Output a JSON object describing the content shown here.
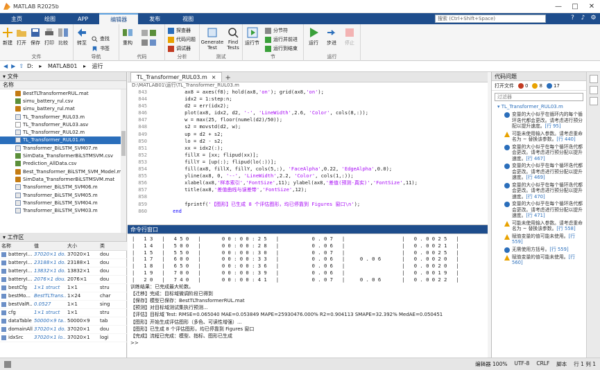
{
  "window": {
    "title": "MATLAB R2025b",
    "controls": [
      "—",
      "□",
      "✕"
    ]
  },
  "tabs": [
    {
      "label": "主页",
      "active": false
    },
    {
      "label": "绘图",
      "active": false
    },
    {
      "label": "APP",
      "active": false
    },
    {
      "label": "编辑器",
      "active": true
    },
    {
      "label": "发布",
      "active": false
    },
    {
      "label": "视图",
      "active": false
    }
  ],
  "search": {
    "placeholder": "搜索 (Ctrl+Shift+Space)"
  },
  "ribbon": {
    "file": {
      "label": "文件",
      "new": "新建",
      "open": "打开",
      "save": "保存",
      "print": "打印",
      "compare": "比较"
    },
    "navigate": {
      "label": "导航",
      "goto": "转至",
      "find": "查找",
      "bookmark": "书签"
    },
    "code": {
      "label": "代码",
      "refactor": "重构"
    },
    "analyze": {
      "label": "分析",
      "profiler": "探查器",
      "code_issues": "代码问题",
      "debugger": "调试器"
    },
    "test": {
      "label": "测试",
      "generate": "Generate Test",
      "find_tests": "Find Tests"
    },
    "section": {
      "label": "节",
      "run_section": "运行节",
      "section_break": "分节符",
      "run_advance": "运行并前进",
      "run_end": "运行到结束"
    },
    "run": {
      "label": "运行",
      "run": "运行",
      "step": "步进",
      "stop": "停止"
    }
  },
  "address": {
    "parts": [
      "D:",
      "MATLAB01",
      "运行"
    ]
  },
  "files": {
    "panel_title": "文件",
    "col_name": "名称",
    "items": [
      {
        "name": "BestTLTransformerRUL.mat",
        "type": "mat"
      },
      {
        "name": "simu_battery_rul.csv",
        "type": "csv"
      },
      {
        "name": "simu_battery_rul.mat",
        "type": "mat"
      },
      {
        "name": "TL_Transformer_RUL03.m",
        "type": "m"
      },
      {
        "name": "TL_Transformer_RUL03.asv",
        "type": "asv"
      },
      {
        "name": "TL_Transformer_RUL02.m",
        "type": "m"
      },
      {
        "name": "TL_Transformer_RUL01.m",
        "type": "m",
        "selected": true
      },
      {
        "name": "Transformer_BiLSTM_SVM07.m",
        "type": "m"
      },
      {
        "name": "SimData_TransformerBiLSTMSVM.csv",
        "type": "csv"
      },
      {
        "name": "Prediction_AllData.csv",
        "type": "csv"
      },
      {
        "name": "Best_Transformer_BiLSTM_SVM_Model.mat",
        "type": "mat"
      },
      {
        "name": "SimData_TransformerBiLSTMSVM.mat",
        "type": "mat"
      },
      {
        "name": "Transformer_BiLSTM_SVM06.m",
        "type": "m"
      },
      {
        "name": "Transformer_BiLSTM_SVM05.m",
        "type": "m"
      },
      {
        "name": "Transformer_BiLSTM_SVM04.m",
        "type": "m"
      },
      {
        "name": "Transformer_BiLSTM_SVM03.m",
        "type": "m"
      }
    ]
  },
  "workspace": {
    "panel_title": "工作区",
    "cols": [
      "名称",
      "值",
      "大小",
      "类"
    ],
    "rows": [
      [
        "batteryI...",
        "37020×1 do...",
        "37020×1",
        "dou"
      ],
      [
        "batteryI...",
        "23188×1 do...",
        "23188×1",
        "dou"
      ],
      [
        "batteryI...",
        "13832×1 do...",
        "13832×1",
        "dou"
      ],
      [
        "batteryI...",
        "2076×1 dou...",
        "2076×1",
        "dou"
      ],
      [
        "bestCfg",
        "1×1 struct",
        "1×1",
        "stru"
      ],
      [
        "bestMo...",
        "BestTLTrans...",
        "1×24",
        "char"
      ],
      [
        "bestValR...",
        "0.0527",
        "1×1",
        "sing"
      ],
      [
        "cfg",
        "1×1 struct",
        "1×1",
        "stru"
      ],
      [
        "dataTable",
        "50000×9 ta...",
        "50000×9",
        "tab"
      ],
      [
        "domainAll",
        "37020×1 do...",
        "37020×1",
        "dou"
      ],
      [
        "idxSrc",
        "37020×1 lo...",
        "37020×1",
        "logi"
      ]
    ]
  },
  "editor": {
    "tab_title": "TL_Transformer_RUL03.m",
    "tab_close": "×",
    "breadcrumb": "D:\\MATLAB01\\运行\\TL_Transformer_RUL03.m",
    "lines": [
      {
        "n": "843",
        "code": "        ax8 = axes(f8); hold(ax8,'on'); grid(ax8,'on');"
      },
      {
        "n": "844",
        "code": "        idx2 = 1:step:n;"
      },
      {
        "n": "845",
        "code": "        d2 = err(idx2);"
      },
      {
        "n": "846",
        "code": "        plot(ax8, idx2, d2, '-', 'LineWidth',2.6, 'Color', cols(8,:));"
      },
      {
        "n": "847",
        "code": "        w = max(25, floor(numel(d2)/50));"
      },
      {
        "n": "848",
        "code": "        s2 = movstd(d2, w);"
      },
      {
        "n": "849",
        "code": "        up = d2 + s2;"
      },
      {
        "n": "850",
        "code": "        lo = d2 - s2;"
      },
      {
        "n": "851",
        "code": "        xx = idx2(:);"
      },
      {
        "n": "852",
        "code": "        fillX = [xx; flipud(xx)];"
      },
      {
        "n": "853",
        "code": "        fillY = [up(:); flipud(lo(:))];"
      },
      {
        "n": "854",
        "code": "        fill(ax8, fillX, fillY, cols(5,:), 'FaceAlpha',0.22, 'EdgeAlpha',0.0);"
      },
      {
        "n": "855",
        "code": "        yline(ax8, 0, '--', 'LineWidth',2.2, 'Color', cols(1,:));"
      },
      {
        "n": "856",
        "code": "        xlabel(ax8,'样本索引','FontSize',11); ylabel(ax8,'差值(预测-真实)','FontSize',11);"
      },
      {
        "n": "857",
        "code": "        title(ax8,'差值曲线与误差带','FontSize',12);"
      },
      {
        "n": "858",
        "code": ""
      },
      {
        "n": "859",
        "code": "        fprintf('【图形】已生成 8 个评估图形，均已停靠到 Figures 窗口\\n');"
      },
      {
        "n": "860",
        "code": "    end"
      }
    ]
  },
  "command": {
    "panel_title": "命令行窗口",
    "table_rows": [
      "|   1 3   |   4 5 0   |       0 0 : 0 0 : 2 5   |           0 . 0 7   |                   |   0 . 0 0 2 5   |",
      "|   1 4   |   5 0 0   |       0 0 : 0 0 : 2 8   |           0 . 0 6   |                   |   0 . 0 0 2 1   |",
      "|   1 5   |   5 5 0   |       0 0 : 0 0 : 3 0   |           0 . 0 7   |                   |   0 . 0 0 2 5   |",
      "|   1 7   |   6 0 0   |       0 0 : 0 0 : 3 3   |           0 . 0 6   |     0 . 0 6       |   0 . 0 0 2 0   |",
      "|   1 8   |   6 5 0   |       0 0 : 0 0 : 3 6   |           0 . 0 6   |                   |   0 . 0 0 2 0   |",
      "|   1 9   |   7 0 0   |       0 0 : 0 0 : 3 9   |           0 . 0 6   |                   |   0 . 0 0 1 9   |",
      "|   2 0   |   7 4 0   |       0 0 : 0 0 : 4 1   |           0 . 0 7   |     0 . 0 6       |   0 . 0 0 2 2   |"
    ],
    "log": [
      "训练结果：已完成最大轮数。",
      "【迁移】完成：目标域微调阶段已得到",
      "【保存】模型已保存：BestTLTransformerRUL.mat",
      "【预测】对目标域测试集执行预测...",
      "【评估】目标域 Test: RMSE=0.065040 MAE=0.053849 MAPE=25930476.000% R2=0.904113 SMAPE=32.392% MedAE=0.050451",
      "【图形】开始生成评估图形（多色、可读性增强）...",
      "【图形】已生成 8 个评估图形，均已停靠到 Figures 窗口",
      "【完成】流程已完成：模型、指标、图形已生成"
    ],
    "prompt": ">>"
  },
  "issues": {
    "panel_title": "代码问题",
    "filter_open": "打开文件",
    "errors": "0",
    "warnings": "8",
    "infos": "17",
    "filter_placeholder": "过滤器",
    "file": "TL_Transformer_RUL03.m",
    "items": [
      {
        "kind": "info",
        "text": "变量的大小似乎在循环内的每个循环迭代都会更改。请考虑进行预分配以提升速度。",
        "ref": "[行 95]"
      },
      {
        "kind": "warn",
        "text": "可能未使用输入参数。请考虑重命名为 ~ 替换该参数。",
        "ref": "[行 440]"
      },
      {
        "kind": "info",
        "text": "变量的大小似乎在每个循环迭代都会更改。请考虑进行预分配以提升速度。",
        "ref": "[行 467]"
      },
      {
        "kind": "info",
        "text": "变量的大小似乎在每个循环迭代都会更改。请考虑进行预分配以提升速度。",
        "ref": "[行 469]"
      },
      {
        "kind": "info",
        "text": "变量的大小似乎在每个循环迭代都会更改。请考虑进行预分配以提升速度。",
        "ref": "[行 470]"
      },
      {
        "kind": "info",
        "text": "变量的大小似乎在每个循环迭代都会更改。请考虑进行预分配以提升速度。",
        "ref": "[行 471]"
      },
      {
        "kind": "warn",
        "text": "可能未使用输入参数。请考虑重命名为 ~ 替换该参数。",
        "ref": "[行 558]"
      },
      {
        "kind": "warn",
        "text": "赋值变量的值可能未使用。",
        "ref": "[行 559]"
      },
      {
        "kind": "info",
        "text": "无需使用方括号。",
        "ref": "[行 559]"
      },
      {
        "kind": "warn",
        "text": "赋值变量的值可能未使用。",
        "ref": "[行 560]"
      }
    ]
  },
  "status": {
    "zoom": "编辑器 100%",
    "encoding": "UTF-8",
    "eol": "CRLF",
    "file_type": "脚本",
    "position": "行 1  列 1"
  },
  "colors": {
    "accent": "#1e4d8c",
    "selection": "#2a6ebb",
    "keyword": "#0e00ff",
    "string": "#a709f5"
  },
  "icons": [
    "new-icon",
    "open-icon",
    "save-icon",
    "print-icon",
    "compare-icon",
    "run-icon",
    "step-icon",
    "stop-icon"
  ]
}
